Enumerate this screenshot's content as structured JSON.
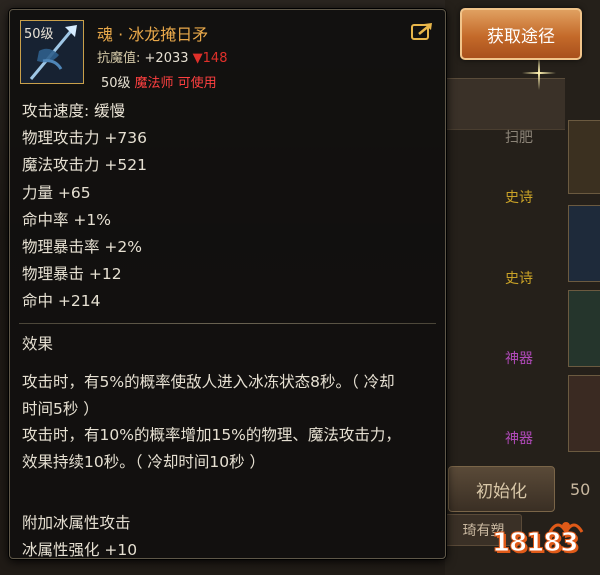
{
  "item": {
    "level_badge": "50级",
    "name": "魂 · 冰龙掩日矛",
    "resist_label": "抗魔值:",
    "resist_value": "+2033",
    "resist_change": "▼148",
    "req_level": "50级",
    "req_class": "魔法师 可使用"
  },
  "stats": [
    "攻击速度: 缓慢",
    "物理攻击力 +736",
    "魔法攻击力 +521",
    "力量 +65",
    "命中率 +1%",
    "物理暴击率 +2%",
    "物理暴击 +12",
    "命中 +214"
  ],
  "effect": {
    "title": "效果",
    "lines": [
      "攻击时，有5%的概率使敌人进入冰冻状态8秒。（ 冷却",
      "时间5秒 ）",
      "攻击时，有10%的概率增加15%的物理、魔法攻击力，",
      "效果持续10秒。（ 冷却时间10秒 ）"
    ]
  },
  "extra": {
    "line1": "附加冰属性攻击",
    "line2": "冰属性强化 +10"
  },
  "side": {
    "acquire_button": "获取途径",
    "tags": [
      "扫肥",
      "史诗",
      "史诗",
      "神器",
      "神器"
    ],
    "init_button": "初始化",
    "side_number": "50",
    "bottom_button": "琦有塑"
  },
  "watermark": "18183",
  "colors": {
    "item_name": "#e8a84a",
    "class_restriction": "#ff4040",
    "resist_down": "#e0302a",
    "epic": "#c9a227",
    "artifact": "#b04ab8"
  },
  "icons": [
    "ice-dragon-spear-icon",
    "share-icon",
    "sparkle-icon"
  ]
}
